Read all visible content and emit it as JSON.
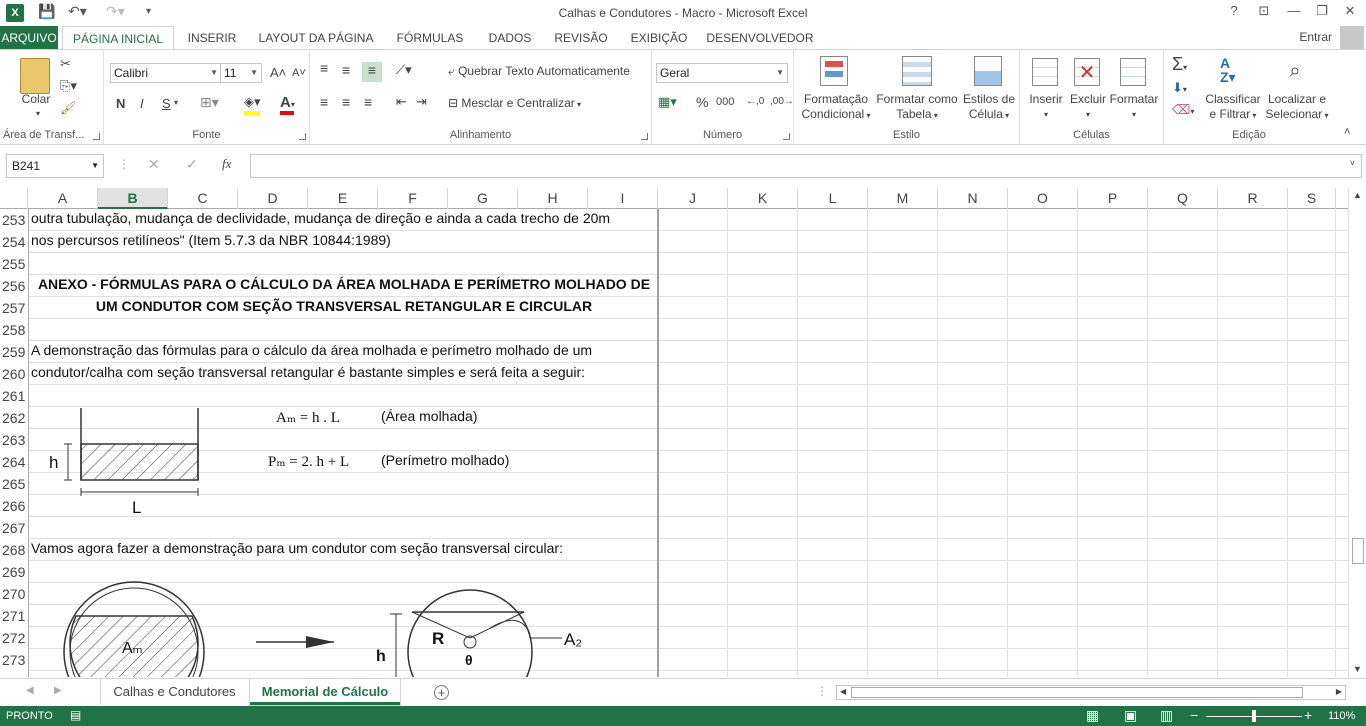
{
  "window": {
    "title": "Calhas e Condutores - Macro - Microsoft Excel",
    "help": "?",
    "controls": [
      "⊡",
      "—",
      "❐",
      "✕"
    ]
  },
  "ribbon_tabs": [
    "ARQUIVO",
    "PÁGINA INICIAL",
    "INSERIR",
    "LAYOUT DA PÁGINA",
    "FÓRMULAS",
    "DADOS",
    "REVISÃO",
    "EXIBIÇÃO",
    "DESENVOLVEDOR"
  ],
  "account": {
    "signin": "Entrar"
  },
  "clipboard": {
    "paste": "Colar",
    "label": "Área de Transf..."
  },
  "font": {
    "name": "Calibri",
    "size": "11",
    "bold": "N",
    "italic": "I",
    "underline": "S",
    "grow": "A",
    "shrink": "A",
    "color_letter": "A",
    "fill_color": "#ffff00",
    "font_color": "#ff0000",
    "label": "Fonte"
  },
  "alignment": {
    "wrap": "Quebrar Texto Automaticamente",
    "merge": "Mesclar e Centralizar",
    "label": "Alinhamento"
  },
  "number": {
    "format": "Geral",
    "percent": "%",
    "thousands": "000",
    "label": "Número"
  },
  "styles": {
    "cond": [
      "Formatação",
      "Condicional"
    ],
    "table": [
      "Formatar como",
      "Tabela"
    ],
    "cell": [
      "Estilos de",
      "Célula"
    ],
    "label": "Estilo"
  },
  "cells": {
    "insert": "Inserir",
    "delete": "Excluir",
    "format": "Formatar",
    "label": "Células"
  },
  "editing": {
    "sort": [
      "Classificar",
      "e Filtrar"
    ],
    "find": [
      "Localizar e",
      "Selecionar"
    ],
    "label": "Edição"
  },
  "formula_bar": {
    "name_box": "B241",
    "fx": "fx",
    "content": ""
  },
  "columns": [
    "A",
    "B",
    "C",
    "D",
    "E",
    "F",
    "G",
    "H",
    "I",
    "J",
    "K",
    "L",
    "M",
    "N",
    "O",
    "P",
    "Q",
    "R",
    "S"
  ],
  "selected_column": "B",
  "rows": [
    "253",
    "254",
    "255",
    "256",
    "257",
    "258",
    "259",
    "260",
    "261",
    "262",
    "263",
    "264",
    "265",
    "266",
    "267",
    "268",
    "269",
    "270",
    "271",
    "272",
    "273"
  ],
  "content": {
    "r253": "outra tubulação, mudança de declividade, mudança de direção e ainda a cada trecho de 20m",
    "r254": "nos percursos retilíneos\" (Item 5.7.3 da NBR 10844:1989)",
    "r256": "ANEXO - FÓRMULAS PARA O CÁLCULO DA ÁREA MOLHADA E PERÍMETRO MOLHADO DE",
    "r257": "UM CONDUTOR COM SEÇÃO TRANSVERSAL RETANGULAR E CIRCULAR",
    "r259": "A demonstração das fórmulas para o cálculo da área molhada e perímetro molhado de um",
    "r260": "condutor/calha com seção transversal retangular é bastante simples e será feita a seguir:",
    "formula1": "Aₘ = h . L",
    "formula1_desc": "(Área molhada)",
    "formula2": "Pₘ = 2. h + L",
    "formula2_desc": "(Perímetro molhado)",
    "r268": "Vamos agora fazer a demonstração para um condutor com seção transversal circular:"
  },
  "diagram": {
    "h": "h",
    "L": "L",
    "Am": "Aₘ",
    "R": "R",
    "theta": "θ",
    "A2": "A₂",
    "h2": "h"
  },
  "sheets": [
    "Calhas e Condutores",
    "Memorial de Cálculo"
  ],
  "active_sheet": "Memorial de Cálculo",
  "status": {
    "mode": "PRONTO",
    "zoom": "110%"
  }
}
